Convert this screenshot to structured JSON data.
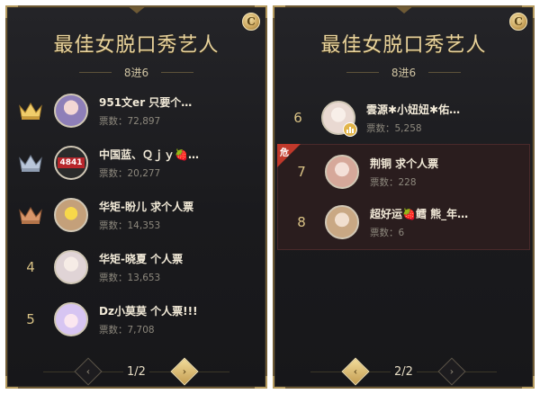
{
  "colors": {
    "gold": "#e7d29c",
    "panel_bg": "#1a1a1d",
    "danger": "#c0392b",
    "crown_gold": "#f0cd6b",
    "crown_silver": "#b9c6da",
    "crown_bronze": "#d8966a"
  },
  "coin_icon": "C",
  "left_panel": {
    "title": "最佳女脱口秀艺人",
    "subtitle": "8进6",
    "rows": [
      {
        "rank": "",
        "crown": "gold",
        "name": "951文er 只要个…",
        "votes": "票数：72,897",
        "avatar_color": "#8e7fb8"
      },
      {
        "rank": "",
        "crown": "silver",
        "name": "中国蓝、Ｑｊｙ🍓…",
        "votes": "票数：20,277",
        "avatar_color": "#2b2b2b",
        "avatar_text": "4841"
      },
      {
        "rank": "",
        "crown": "bronze",
        "name": "华矩-盼儿 求个人票",
        "votes": "票数：14,353",
        "avatar_color": "#c4a07a"
      },
      {
        "rank": "4",
        "crown": "",
        "name": "华矩-晓夏 个人票",
        "votes": "票数：13,653",
        "avatar_color": "#e0d4d6"
      },
      {
        "rank": "5",
        "crown": "",
        "name": "Dz小莫莫 个人票!!!",
        "votes": "票数：7,708",
        "avatar_color": "#d7c5f2"
      }
    ],
    "pager": {
      "label": "1/2",
      "prev": "‹",
      "next": "›"
    }
  },
  "right_panel": {
    "title": "最佳女脱口秀艺人",
    "subtitle": "8进6",
    "danger_label": "危",
    "top_row": {
      "rank": "6",
      "name": "雲源✱小妞妞✱佑…",
      "votes": "票数：5,258",
      "avatar_color": "#e9d9d2"
    },
    "danger_rows": [
      {
        "rank": "7",
        "name": "荆铜 求个人票",
        "votes": "票数：228",
        "avatar_color": "#d6a89a"
      },
      {
        "rank": "8",
        "name": "超好运🍓鳕 熊_年…",
        "votes": "票数：6",
        "avatar_color": "#c9a884"
      }
    ],
    "pager": {
      "label": "2/2",
      "prev": "‹",
      "next": "›"
    }
  }
}
